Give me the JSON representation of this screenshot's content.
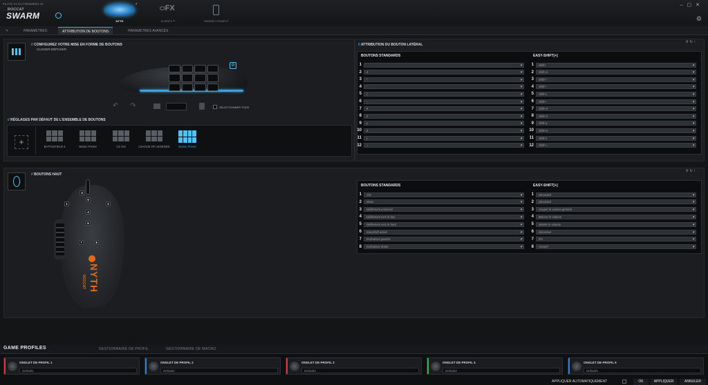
{
  "header": {
    "version": "PILOTE V1.43 | FIRMWARE1.35",
    "brand_top": "ROCCAT",
    "brand_main": "SWARM",
    "devices": [
      {
        "label": "NYTH",
        "active": true
      },
      {
        "label": "ALIENFX™",
        "active": false
      },
      {
        "label": "SWARM CONNECT",
        "active": false
      }
    ],
    "alienfx_logo": "FX"
  },
  "tabs": [
    {
      "label": "PARAMÈTRES",
      "active": false
    },
    {
      "label": "ATTRIBUTION DE BOUTONS",
      "active": true
    },
    {
      "label": "PARAMÈTRES AVANCÉS",
      "active": false
    }
  ],
  "config": {
    "title_slash": "//",
    "title": "CONFIGUREZ VOTRE MISE EN FORME DE BOUTONS",
    "subtitle": "GLISSER-DÉPOSER",
    "select_all": "SÉLECTIONNER TOUS"
  },
  "presets": {
    "title": "RÉGLAGES PAR DÉFAUT DE L'ENSEMBLE DE BOUTONS",
    "items": [
      {
        "label": "BATTLEFIELD 4"
      },
      {
        "label": "Button Preset"
      },
      {
        "label": "CS GO"
      },
      {
        "label": "LEAGUE OF LEGENDS"
      },
      {
        "label": "Button Preset"
      }
    ]
  },
  "side": {
    "title": "ATTRIBUTION DU BOUTON LATÉRAL",
    "col_standard": "BOUTONS STANDARDS",
    "col_easy": "EASY-SHIFT[+]",
    "rows": [
      {
        "n": "1",
        "std": "",
        "easy": "Shift+"
      },
      {
        "n": "2",
        "std": "é",
        "easy": "Shift+é"
      },
      {
        "n": "3",
        "std": "\"",
        "easy": "Shift+\""
      },
      {
        "n": "4",
        "std": "'",
        "easy": "Shift+'"
      },
      {
        "n": "5",
        "std": "(",
        "easy": "Shift+("
      },
      {
        "n": "6",
        "std": "-",
        "easy": "Shift+-"
      },
      {
        "n": "7",
        "std": "è",
        "easy": "Shift+è"
      },
      {
        "n": "8",
        "std": "è",
        "easy": "Shift+è"
      },
      {
        "n": "9",
        "std": "ç",
        "easy": "Shift+ç"
      },
      {
        "n": "10",
        "std": "à",
        "easy": "Shift+à"
      },
      {
        "n": "11",
        "std": ")",
        "easy": "Shift+)"
      },
      {
        "n": "12",
        "std": "=",
        "easy": "Shift+="
      }
    ]
  },
  "top": {
    "title": "BOUTONS HAUT",
    "col_standard": "BOUTONS STANDARDS",
    "col_easy": "EASY-SHIFT[+]",
    "rows": [
      {
        "n": "1",
        "std": "Clic",
        "easy": "Désactivé"
      },
      {
        "n": "2",
        "std": "Menu",
        "easy": "Désactivé"
      },
      {
        "n": "3",
        "std": "Défilement universel",
        "easy": "Couper le volume général"
      },
      {
        "n": "4",
        "std": "Défilement vers le bas",
        "easy": "Baisser le volume"
      },
      {
        "n": "5",
        "std": "Défilement vers le haut",
        "easy": "Monter le volume"
      },
      {
        "n": "6",
        "std": "EasyShift activé",
        "easy": "Désactivé"
      },
      {
        "n": "7",
        "std": "Inclinaison gauche",
        "easy": "Fin"
      },
      {
        "n": "8",
        "std": "Inclinaison droite",
        "easy": "Accueil"
      }
    ],
    "mouse_keys": [
      "1",
      "2",
      "3",
      "4",
      "5",
      "6",
      "7",
      "8"
    ],
    "mouse_brand": "ROCCAT",
    "mouse_model": "NYTH"
  },
  "bottom": {
    "tabs": [
      {
        "label": "GAME PROFILES",
        "active": true
      },
      {
        "label": "GESTIONNAIRE DE PROFIL",
        "active": false
      },
      {
        "label": "GESTIONNAIRE DE MACRO",
        "active": false
      }
    ],
    "profiles": [
      {
        "title": "ONGLET DE PROFIL 1",
        "name": "Default1",
        "color": "#e0343b"
      },
      {
        "title": "ONGLET DE PROFIL 2",
        "name": "Default2",
        "color": "#2f7fe0"
      },
      {
        "title": "ONGLET DE PROFIL 3",
        "name": "Default3",
        "color": "#e0343b"
      },
      {
        "title": "ONGLET DE PROFIL 4",
        "name": "Default4",
        "color": "#27c24a"
      },
      {
        "title": "ONGLET DE PROFIL 5",
        "name": "Default5",
        "color": "#2f7fe0"
      }
    ],
    "auto_apply": "APPLIQUER AUTOMATIQUEMENT",
    "ok": "OK",
    "apply": "APPLIQUER",
    "cancel": "ANNULER"
  },
  "accent": "#3aa5e0"
}
